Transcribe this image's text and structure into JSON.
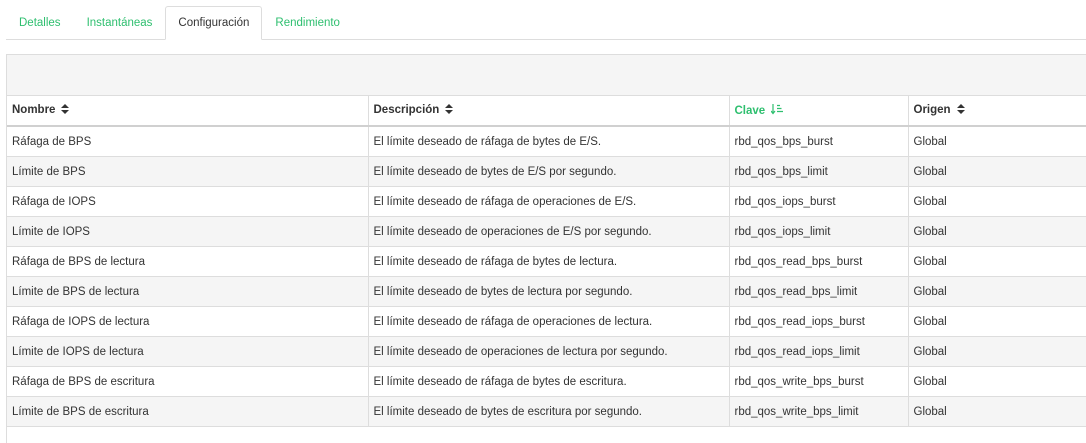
{
  "tabs": [
    {
      "label": "Detalles"
    },
    {
      "label": "Instantáneas"
    },
    {
      "label": "Configuración"
    },
    {
      "label": "Rendimiento"
    }
  ],
  "table": {
    "headers": [
      "Nombre",
      "Descripción",
      "Clave",
      "Origen"
    ],
    "rows": [
      [
        "Ráfaga de BPS",
        "El límite deseado de ráfaga de bytes de E/S.",
        "rbd_qos_bps_burst",
        "Global"
      ],
      [
        "Límite de BPS",
        "El límite deseado de bytes de E/S por segundo.",
        "rbd_qos_bps_limit",
        "Global"
      ],
      [
        "Ráfaga de IOPS",
        "El límite deseado de ráfaga de operaciones de E/S.",
        "rbd_qos_iops_burst",
        "Global"
      ],
      [
        "Límite de IOPS",
        "El límite deseado de operaciones de E/S por segundo.",
        "rbd_qos_iops_limit",
        "Global"
      ],
      [
        "Ráfaga de BPS de lectura",
        "El límite deseado de ráfaga de bytes de lectura.",
        "rbd_qos_read_bps_burst",
        "Global"
      ],
      [
        "Límite de BPS de lectura",
        "El límite deseado de bytes de lectura por segundo.",
        "rbd_qos_read_bps_limit",
        "Global"
      ],
      [
        "Ráfaga de IOPS de lectura",
        "El límite deseado de ráfaga de operaciones de lectura.",
        "rbd_qos_read_iops_burst",
        "Global"
      ],
      [
        "Límite de IOPS de lectura",
        "El límite deseado de operaciones de lectura por segundo.",
        "rbd_qos_read_iops_limit",
        "Global"
      ],
      [
        "Ráfaga de BPS de escritura",
        "El límite deseado de ráfaga de bytes de escritura.",
        "rbd_qos_write_bps_burst",
        "Global"
      ],
      [
        "Límite de BPS de escritura",
        "El límite deseado de bytes de escritura por segundo.",
        "rbd_qos_write_bps_limit",
        "Global"
      ]
    ]
  },
  "colors": {
    "accent": "#2ebf6f",
    "stripe": "#f5f5f5",
    "border": "#dddddd"
  },
  "icons": {
    "sort": "sort-icon",
    "sort_active": "sort-ascending-icon"
  }
}
